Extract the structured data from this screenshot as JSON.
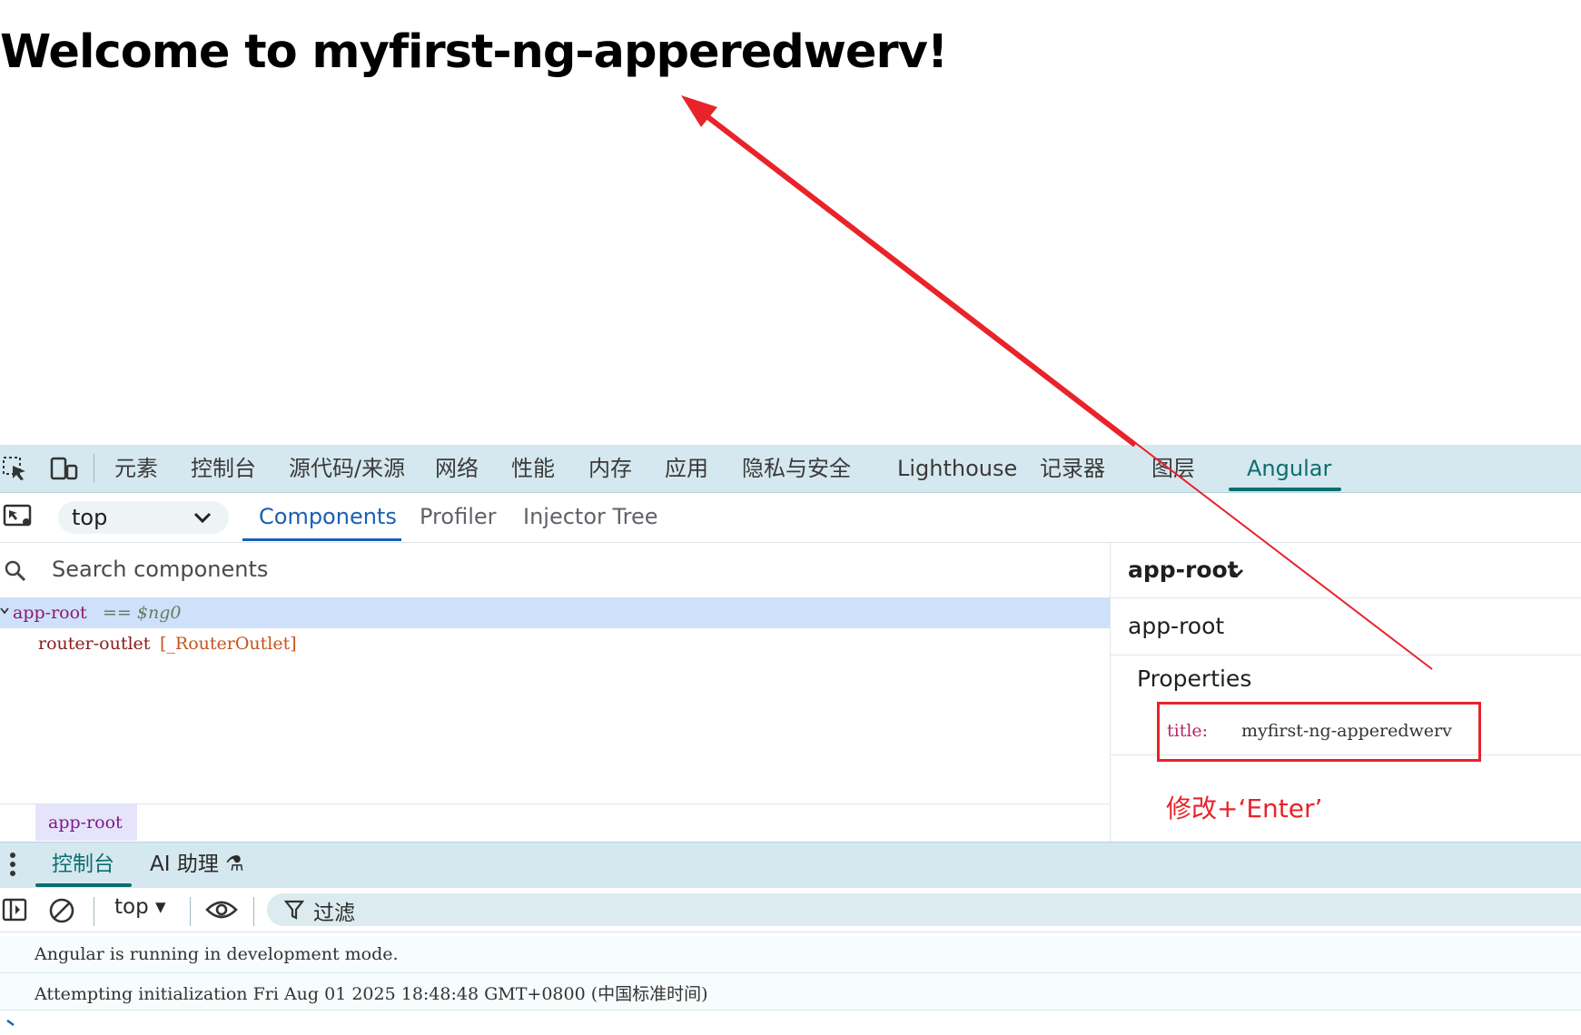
{
  "page": {
    "heading": "Welcome to myfirst-ng-apperedwerv!"
  },
  "devtools": {
    "tabs": [
      "元素",
      "控制台",
      "源代码/来源",
      "网络",
      "性能",
      "内存",
      "应用",
      "隐私与安全",
      "Lighthouse",
      "记录器",
      "图层",
      "Angular"
    ],
    "active_tab": "Angular"
  },
  "angular_panel": {
    "frame_select": "top",
    "tabs": [
      "Components",
      "Profiler",
      "Injector Tree"
    ],
    "active_tab": "Components",
    "search_placeholder": "Search components",
    "tree": {
      "root_label": "app-root",
      "root_ref": "== $ng0",
      "child_label": "router-outlet",
      "child_directive": "[_RouterOutlet]"
    },
    "breadcrumb": "app-root",
    "details": {
      "component_title": "app-root",
      "component_name": "app-root",
      "properties_heading": "Properties",
      "property_key": "title:",
      "property_value": "myfirst-ng-apperedwerv"
    }
  },
  "annotation": {
    "text": "修改+‘Enter’",
    "color": "#e8232a"
  },
  "drawer": {
    "tabs": [
      "控制台",
      "AI 助理 ⚗"
    ],
    "active_tab": "控制台",
    "context": "top ▾",
    "filter_label": "过滤",
    "messages": [
      "Angular is running in development mode.",
      "Attempting initialization Fri Aug 01 2025 18:48:48 GMT+0800 (中国标准时间)"
    ]
  },
  "colors": {
    "tabbar_bg": "#d6e8ef",
    "accent_teal": "#0b6e70",
    "accent_blue": "#1a5fb4",
    "selection_bg": "#cfe0fb"
  }
}
